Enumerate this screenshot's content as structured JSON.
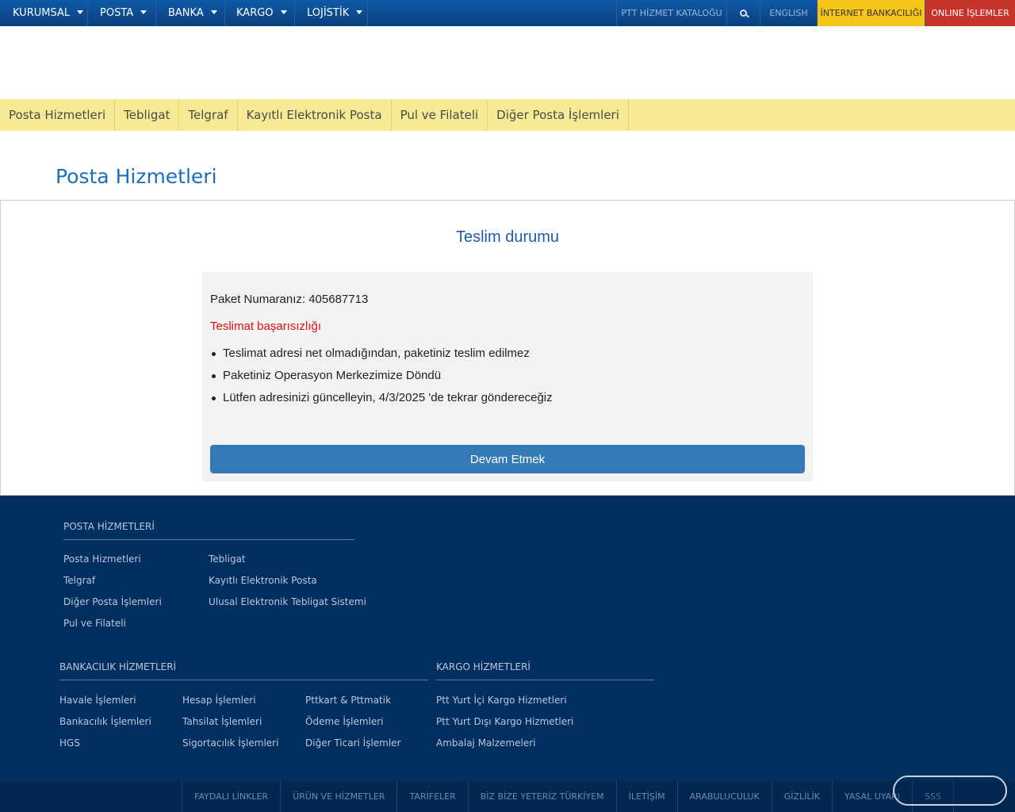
{
  "topnav": {
    "left": [
      {
        "label": "KURUMSAL"
      },
      {
        "label": "POSTA"
      },
      {
        "label": "BANKA"
      },
      {
        "label": "KARGO"
      },
      {
        "label": "LOJİSTİK"
      }
    ],
    "catalog": "PTT HİZMET KATALOĞU",
    "search_icon": "search-icon",
    "english": "ENGLISH",
    "internet_banking": "İNTERNET BANKACILIĞI",
    "online": "ONLINE İŞLEMLER",
    "colors": {
      "bar": "#0a3f7d",
      "yellow": "#f5c518",
      "red": "#c8332c"
    }
  },
  "subnav": [
    "Posta Hizmetleri",
    "Tebligat",
    "Telgraf",
    "Kayıtlı Elektronik Posta",
    "Pul ve Filateli",
    "Diğer Posta İşlemleri"
  ],
  "page_title": "Posta Hizmetleri",
  "status": {
    "title": "Teslim durumu",
    "package_label": "Paket Numaranız: 405687713",
    "failure": "Teslimat başarısızlığı",
    "bullets": [
      "Teslimat adresi net olmadığından, paketiniz teslim edilmez",
      "Paketiniz Operasyon Merkezimize Döndü",
      "Lütfen adresinizi güncelleyin, 4/3/2025 'de tekrar göndereceğiz"
    ],
    "button": "Devam Etmek"
  },
  "footer": {
    "posta": {
      "heading": "POSTA HİZMETLERİ",
      "col1": [
        "Posta Hizmetleri",
        "Telgraf",
        "Diğer Posta İşlemleri",
        "Pul ve Filateli"
      ],
      "col2": [
        "Tebligat",
        "Kayıtlı Elektronik Posta",
        "Ulusal Elektronik Tebligat Sistemi"
      ]
    },
    "banka": {
      "heading": "BANKACILIK HİZMETLERİ",
      "col1": [
        "Havale İşlemleri",
        "Bankacılık İşlemleri",
        "HGS"
      ],
      "col2": [
        "Hesap İşlemleri",
        "Tahsilat İşlemleri",
        "Sigortacılık İşlemleri"
      ],
      "col3": [
        "Pttkart & Pttmatik",
        "Ödeme İşlemleri",
        "Diğer Ticari İşlemler"
      ]
    },
    "kargo": {
      "heading": "KARGO HİZMETLERİ",
      "col1": [
        "Ptt Yurt İçi Kargo Hizmetleri",
        "Ptt Yurt Dışı Kargo Hizmetleri",
        "Ambalaj Malzemeleri"
      ]
    },
    "bottom": [
      "FAYDALI LİNKLER",
      "ÜRÜN VE HİZMETLER",
      "TARİFELER",
      "BİZ BİZE YETERİZ TÜRKİYEM",
      "İLETİŞİM",
      "ARABULUCULUK",
      "GİZLİLİK",
      "YASAL UYARI",
      "SSS"
    ]
  }
}
